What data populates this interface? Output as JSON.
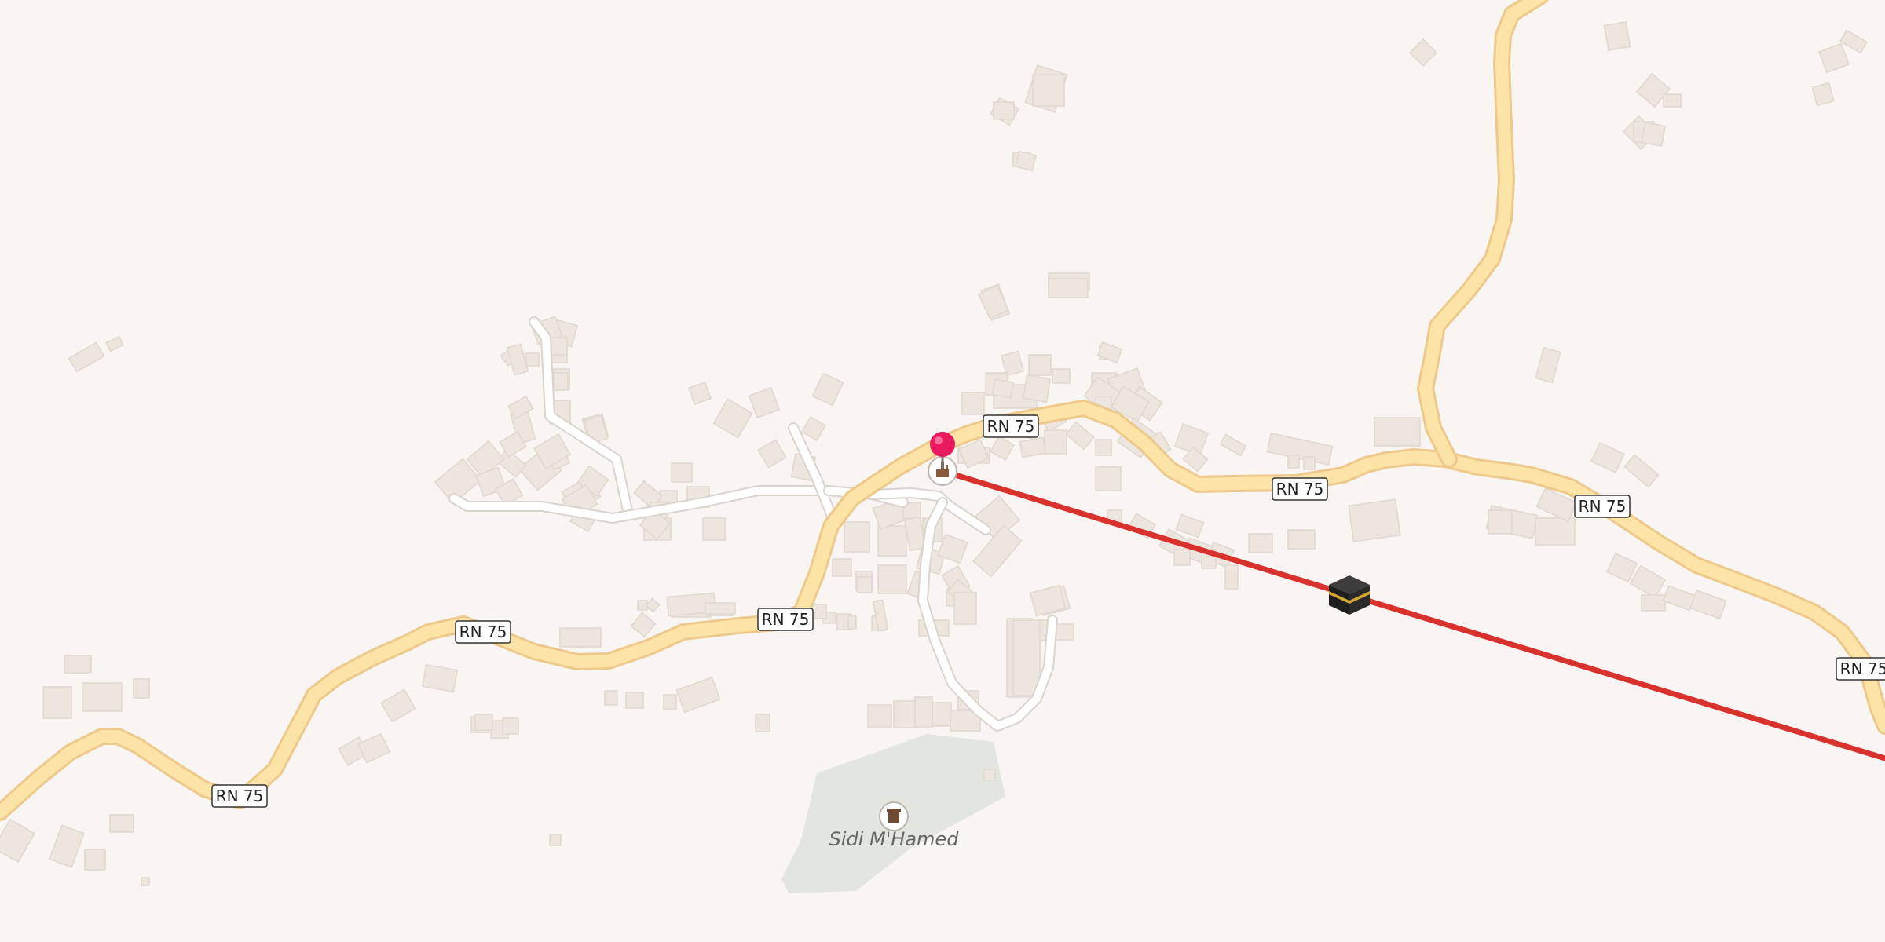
{
  "map": {
    "road_labels": [
      "RN 75",
      "RN 75",
      "RN 75",
      "RN 75",
      "RN 75",
      "RN 75",
      "RN 75"
    ],
    "place_label": "Sidi M'Hamed",
    "icons": {
      "pin": "location-pin-icon",
      "mosque": "mosque-icon",
      "kaaba": "kaaba-icon",
      "shrine": "shrine-icon"
    },
    "colors": {
      "background": "#f8f5f2",
      "primary_road": "#fbe4a6",
      "primary_road_casing": "#edc98c",
      "minor_road": "#ffffff",
      "minor_road_casing": "#d9d4cd",
      "route_line": "#d9322e",
      "pin": "#e8195c",
      "cemetery_area": "#e3e6df"
    }
  }
}
